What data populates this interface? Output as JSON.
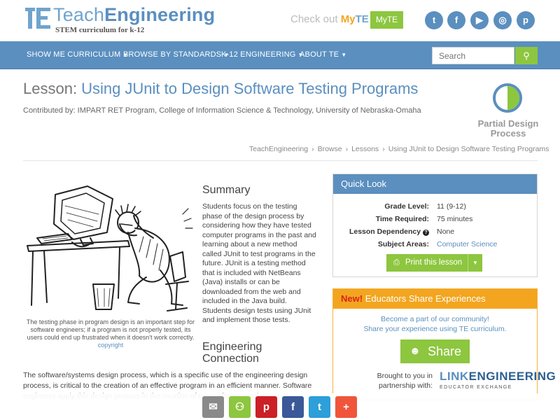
{
  "brand": {
    "name_light": "Teach",
    "name_bold": "Engineering",
    "tagline": "STEM curriculum for k-12",
    "checkout_text": "Check out",
    "myte_prefix": "My",
    "myte_suffix": "TE",
    "myte_button": "MyTE",
    "colors": {
      "primary": "#5b8fbf",
      "green": "#8dc63f",
      "orange": "#f3a51f"
    }
  },
  "social": [
    {
      "name": "twitter-icon",
      "glyph": "t"
    },
    {
      "name": "facebook-icon",
      "glyph": "f"
    },
    {
      "name": "youtube-icon",
      "glyph": "▶"
    },
    {
      "name": "instagram-icon",
      "glyph": "◎"
    },
    {
      "name": "pinterest-icon",
      "glyph": "p"
    }
  ],
  "nav": {
    "items": [
      "SHOW ME CURRICULUM",
      "BROWSE BY STANDARDS",
      "K-12 ENGINEERING",
      "ABOUT TE"
    ],
    "search_placeholder": "Search"
  },
  "lesson": {
    "prefix": "Lesson:",
    "title": "Using JUnit to Design Software Testing Programs",
    "contributed": "Contributed by: IMPART RET Program, College of Information Science & Technology, University of Nebraska-Omaha",
    "design_process_label": "Partial Design Process"
  },
  "breadcrumb": [
    "TeachEngineering",
    "Browse",
    "Lessons",
    "Using JUnit to Design Software Testing Programs"
  ],
  "figure": {
    "caption": "The testing phase in program design is an important step for software engineers; if a program is not properly tested, its users could end up frustrated when it doesn't work correctly.",
    "credit": "copyright"
  },
  "summary": {
    "heading": "Summary",
    "text": "Students focus on the testing phase of the design process by considering how they have tested computer programs in the past and learning about a new method called JUnit to test programs in the future. JUnit is a testing method that is included with NetBeans (Java) installs or can be downloaded from the web and included in the Java build. Students design tests using JUnit and implement those tests."
  },
  "engineering_connection": {
    "heading_line1": "Engineering",
    "heading_line2": "Connection",
    "text": "The software/systems design process, which is a specific use of the engineering design process, is critical to the creation of an effective program in an efficient manner.",
    "text_partial": "Software engineers apply this design process in the creation of new software products"
  },
  "quick_look": {
    "heading": "Quick Look",
    "rows": [
      {
        "label": "Grade Level:",
        "value": "11 (9-12)"
      },
      {
        "label": "Time Required:",
        "value": "75 minutes"
      },
      {
        "label": "Lesson Dependency",
        "value": "None"
      },
      {
        "label": "Subject Areas:",
        "value": "Computer Science"
      }
    ],
    "print_button": "Print this lesson"
  },
  "educators": {
    "new_label": "New!",
    "heading": "Educators Share Experiences",
    "line1": "Become a part of our community!",
    "line2": "Share your experience using TE curriculum.",
    "share_button": "Share",
    "brought_line1": "Brought to you in",
    "brought_line2": "partnership with:",
    "partner_main_a": "LINK",
    "partner_main_b": "ENGINEERING",
    "partner_sub": "EDUCATOR EXCHANGE"
  },
  "share_bar": [
    {
      "name": "email-share-icon",
      "glyph": "✉",
      "color": "#8a8a8a"
    },
    {
      "name": "community-share-icon",
      "glyph": "⚇",
      "color": "#8dc63f"
    },
    {
      "name": "pinterest-share-icon",
      "glyph": "p",
      "color": "#cb2027"
    },
    {
      "name": "facebook-share-icon",
      "glyph": "f",
      "color": "#3b5998"
    },
    {
      "name": "twitter-share-icon",
      "glyph": "t",
      "color": "#2d9fd9"
    },
    {
      "name": "more-share-icon",
      "glyph": "+",
      "color": "#f0553c"
    }
  ]
}
